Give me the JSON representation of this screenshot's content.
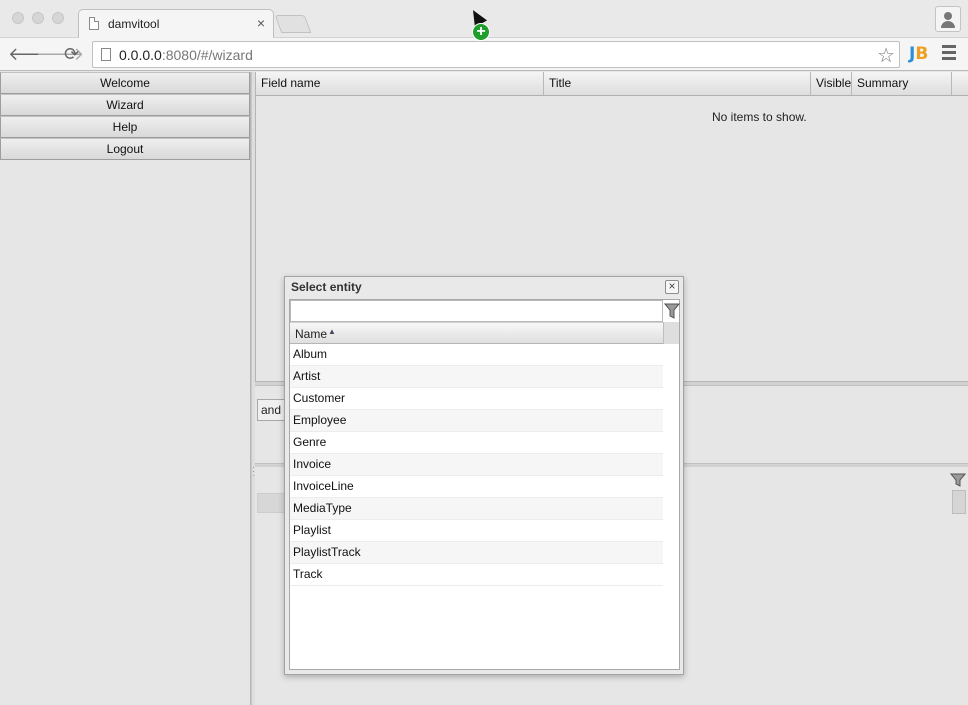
{
  "browser": {
    "tab_title": "damvitool",
    "tab_close": "×",
    "url_host": "0.0.0.0",
    "url_path": ":8080/#/wizard",
    "back_icon": "arrow-left",
    "forward_icon": "arrow-right",
    "reload_icon": "reload",
    "extension_label": "JB"
  },
  "sidebar": {
    "items": [
      {
        "label": "Welcome"
      },
      {
        "label": "Wizard"
      },
      {
        "label": "Help"
      },
      {
        "label": "Logout"
      }
    ]
  },
  "grid": {
    "columns": [
      "Field name",
      "Title",
      "Visible",
      "Summary"
    ],
    "empty_message": "No items to show."
  },
  "mid_panel": {
    "operator": "and"
  },
  "dialog": {
    "title": "Select entity",
    "filter_value": "",
    "column_header": "Name",
    "sort": "ascending",
    "items": [
      "Album",
      "Artist",
      "Customer",
      "Employee",
      "Genre",
      "Invoice",
      "InvoiceLine",
      "MediaType",
      "Playlist",
      "PlaylistTrack",
      "Track"
    ]
  },
  "colors": {
    "accent_green": "#1f9e2d",
    "extension_blue": "#2f8ed8",
    "panel_bg": "#e6e6e6"
  }
}
